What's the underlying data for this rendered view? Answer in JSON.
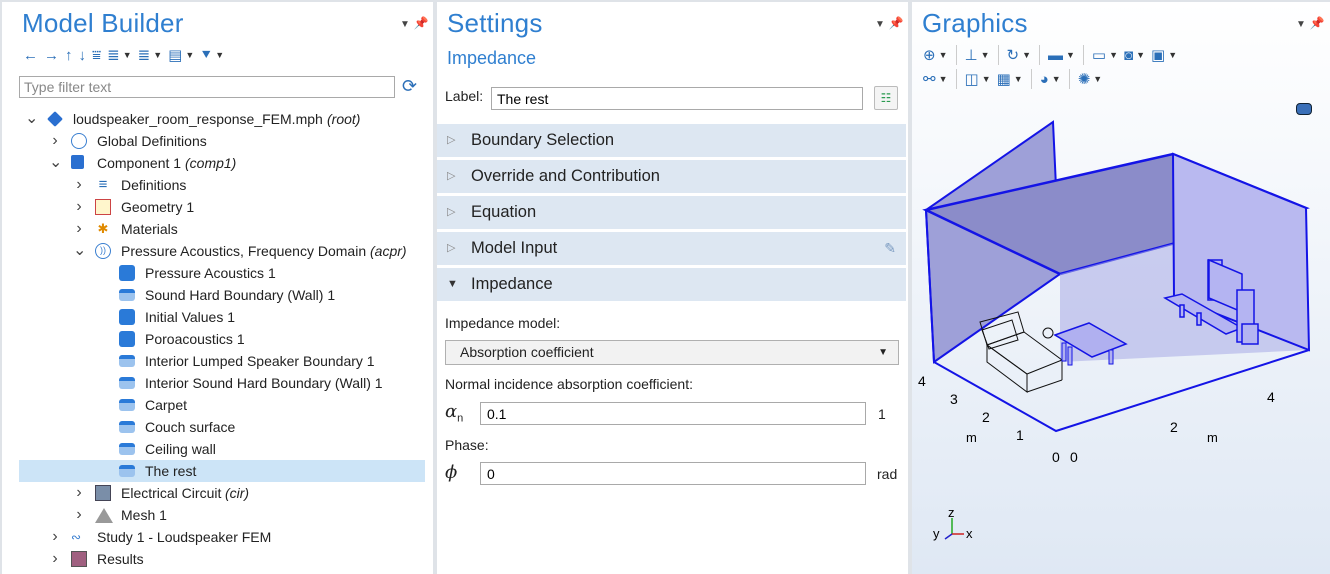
{
  "model_builder": {
    "title": "Model Builder",
    "toolbar": [
      "←",
      "→",
      "↑",
      "↓",
      "⩸",
      "≣↑",
      "≣↓",
      "▤",
      "⯆"
    ],
    "filter_placeholder": "Type filter text",
    "tree": [
      {
        "label": "loudspeaker_room_response_FEM.mph",
        "tag": "(root)",
        "icon": "root-icon",
        "expander": "open",
        "indent": 0
      },
      {
        "label": "Global Definitions",
        "tag": "",
        "icon": "globe-icon",
        "expander": "closed",
        "indent": 1
      },
      {
        "label": "Component 1",
        "tag": "(comp1)",
        "icon": "component-icon",
        "expander": "open",
        "indent": 1
      },
      {
        "label": "Definitions",
        "tag": "",
        "icon": "definitions-icon",
        "expander": "closed",
        "indent": 2
      },
      {
        "label": "Geometry 1",
        "tag": "",
        "icon": "geometry-icon",
        "expander": "closed",
        "indent": 2
      },
      {
        "label": "Materials",
        "tag": "",
        "icon": "materials-icon",
        "expander": "closed",
        "indent": 2
      },
      {
        "label": "Pressure Acoustics, Frequency Domain",
        "tag": "(acpr)",
        "icon": "acoustics-icon",
        "expander": "open",
        "indent": 2
      },
      {
        "label": "Pressure Acoustics 1",
        "tag": "",
        "icon": "domain-feature-icon",
        "expander": "",
        "indent": 3
      },
      {
        "label": "Sound Hard Boundary (Wall) 1",
        "tag": "",
        "icon": "boundary-feature-icon",
        "expander": "",
        "indent": 3
      },
      {
        "label": "Initial Values 1",
        "tag": "",
        "icon": "domain-feature-icon",
        "expander": "",
        "indent": 3
      },
      {
        "label": "Poroacoustics 1",
        "tag": "",
        "icon": "domain-feature-icon",
        "expander": "",
        "indent": 3
      },
      {
        "label": "Interior Lumped Speaker Boundary 1",
        "tag": "",
        "icon": "boundary-feature-icon",
        "expander": "",
        "indent": 3
      },
      {
        "label": "Interior Sound Hard Boundary (Wall) 1",
        "tag": "",
        "icon": "boundary-feature-icon",
        "expander": "",
        "indent": 3
      },
      {
        "label": "Carpet",
        "tag": "",
        "icon": "boundary-feature-icon",
        "expander": "",
        "indent": 3
      },
      {
        "label": "Couch surface",
        "tag": "",
        "icon": "boundary-feature-icon",
        "expander": "",
        "indent": 3
      },
      {
        "label": "Ceiling wall",
        "tag": "",
        "icon": "boundary-feature-icon",
        "expander": "",
        "indent": 3
      },
      {
        "label": "The rest",
        "tag": "",
        "icon": "boundary-feature-icon",
        "expander": "",
        "indent": 3,
        "selected": true
      },
      {
        "label": "Electrical Circuit",
        "tag": "(cir)",
        "icon": "circuit-icon",
        "expander": "closed",
        "indent": 2
      },
      {
        "label": "Mesh 1",
        "tag": "",
        "icon": "mesh-icon",
        "expander": "closed",
        "indent": 2
      },
      {
        "label": "Study 1 - Loudspeaker FEM",
        "tag": "",
        "icon": "study-icon",
        "expander": "closed",
        "indent": 1
      },
      {
        "label": "Results",
        "tag": "",
        "icon": "results-icon",
        "expander": "closed",
        "indent": 1
      }
    ]
  },
  "settings": {
    "title": "Settings",
    "subtitle": "Impedance",
    "label_caption": "Label:",
    "label_value": "The rest",
    "sections": [
      {
        "label": "Boundary Selection",
        "open": false
      },
      {
        "label": "Override and Contribution",
        "open": false
      },
      {
        "label": "Equation",
        "open": false
      },
      {
        "label": "Model Input",
        "open": false
      },
      {
        "label": "Impedance",
        "open": true
      }
    ],
    "impedance_model_label": "Impedance model:",
    "impedance_model_value": "Absorption coefficient",
    "absorption_label": "Normal incidence absorption coefficient:",
    "alpha_symbol": "α",
    "alpha_sub": "n",
    "alpha_value": "0.1",
    "alpha_unit": "1",
    "phase_label": "Phase:",
    "phase_symbol": "ϕ",
    "phase_value": "0",
    "phase_unit": "rad"
  },
  "graphics": {
    "title": "Graphics",
    "axis_ticks_left": [
      "4",
      "3",
      "2",
      "1",
      "0"
    ],
    "axis_ticks_right": [
      "4",
      "2",
      "0"
    ],
    "unit_left": "m",
    "unit_right": "m",
    "triad": {
      "z": "z",
      "y": "y",
      "x": "x"
    }
  },
  "colors": {
    "accent_blue": "#2f7fd0",
    "selection": "#cce4f7",
    "section_bg": "#dde7f2",
    "highlight_face": "#9797d8",
    "highlight_edge": "#1010e0"
  }
}
